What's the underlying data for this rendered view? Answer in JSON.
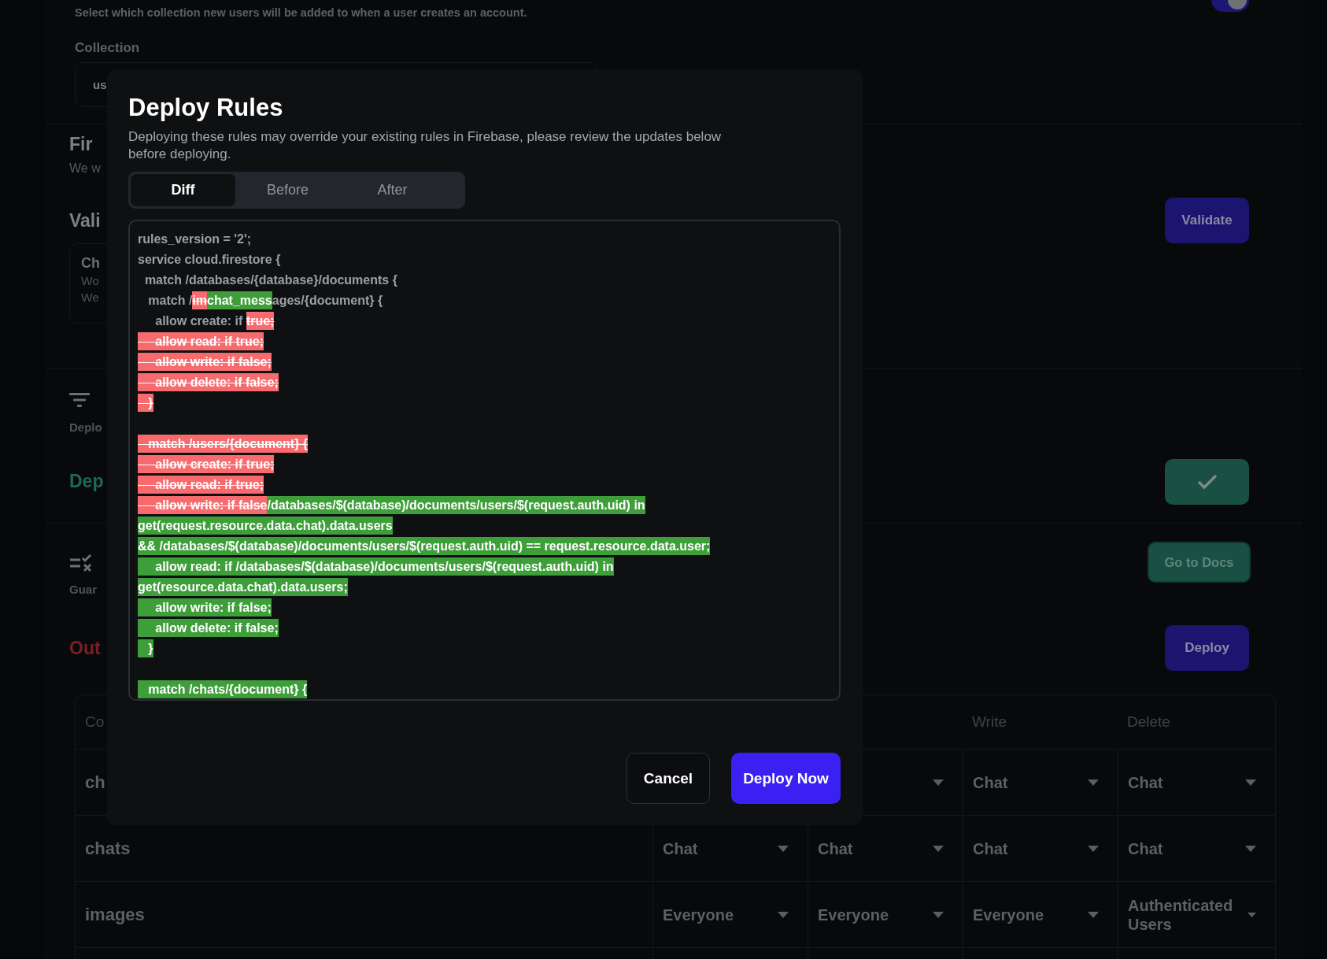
{
  "page": {
    "collection_hint": "Select which collection new users will be added to when a user creates an account.",
    "toggle": {
      "on": true
    },
    "collection_label": "Collection",
    "collection_field": {
      "value": "us"
    },
    "firestore": {
      "heading": "Fir",
      "text": "We w"
    },
    "validate": {
      "heading": "Vali",
      "button": "Validate",
      "card": {
        "title": "Ch",
        "lines": [
          "Wo",
          "We"
        ]
      }
    },
    "deploy_status": {
      "label": "Deplo",
      "heading": "Dep"
    },
    "guard": {
      "label": "Guar",
      "button": "Go to Docs"
    },
    "output": {
      "heading": "Out",
      "button": "Deploy"
    },
    "table": {
      "columns": [
        "Co",
        "",
        "",
        "Write",
        "Delete"
      ],
      "rows": [
        {
          "cells": [
            "ch",
            "",
            "",
            "Chat",
            "Chat"
          ]
        },
        {
          "cells": [
            "chats",
            "Chat",
            "Chat",
            "Chat",
            "Chat"
          ]
        },
        {
          "cells": [
            "images",
            "Everyone",
            "Everyone",
            "Everyone",
            "Authenticated Users"
          ]
        }
      ]
    }
  },
  "dialog": {
    "title": "Deploy Rules",
    "description": "Deploying these rules may override your existing rules in Firebase, please review the updates below before deploying.",
    "tabs": [
      {
        "label": "Diff",
        "selected": true
      },
      {
        "label": "Before",
        "selected": false
      },
      {
        "label": "After",
        "selected": false
      }
    ],
    "diff_lines": [
      {
        "kind": "code",
        "segments": [
          {
            "kind": "same",
            "text": "rules_version = '2';"
          }
        ]
      },
      {
        "kind": "code",
        "segments": [
          {
            "kind": "same",
            "text": "service cloud.firestore {"
          }
        ]
      },
      {
        "kind": "code",
        "segments": [
          {
            "kind": "same",
            "text": "  match /databases/{database}/documents {"
          }
        ]
      },
      {
        "kind": "code",
        "segments": [
          {
            "kind": "same",
            "text": "   match /"
          },
          {
            "kind": "removed",
            "text": "im"
          },
          {
            "kind": "added",
            "text": "chat_mess"
          },
          {
            "kind": "same",
            "text": "ages/{document} {"
          }
        ]
      },
      {
        "kind": "code",
        "segments": [
          {
            "kind": "same",
            "text": "     allow create: if "
          },
          {
            "kind": "removed",
            "text": "true;"
          }
        ]
      },
      {
        "kind": "code",
        "segments": [
          {
            "kind": "removed",
            "text": "     allow read: if true;"
          }
        ]
      },
      {
        "kind": "code",
        "segments": [
          {
            "kind": "removed",
            "text": "     allow write: if false;"
          }
        ]
      },
      {
        "kind": "code",
        "segments": [
          {
            "kind": "removed",
            "text": "     allow delete: if false;"
          }
        ]
      },
      {
        "kind": "code",
        "segments": [
          {
            "kind": "removed",
            "text": "   }"
          }
        ]
      },
      {
        "kind": "blank"
      },
      {
        "kind": "code",
        "segments": [
          {
            "kind": "removed",
            "text": "   match /users/{document} {"
          }
        ]
      },
      {
        "kind": "code",
        "segments": [
          {
            "kind": "removed",
            "text": "     allow create: if true;"
          }
        ]
      },
      {
        "kind": "code",
        "segments": [
          {
            "kind": "removed",
            "text": "     allow read: if true;"
          }
        ]
      },
      {
        "kind": "code",
        "segments": [
          {
            "kind": "removed",
            "text": "     allow write: if false"
          },
          {
            "kind": "added",
            "text": "/databases/$(database)/documents/users/$(request.auth.uid) in"
          }
        ]
      },
      {
        "kind": "code",
        "segments": [
          {
            "kind": "added",
            "text": "get(request.resource.data.chat).data.users"
          }
        ]
      },
      {
        "kind": "code",
        "segments": [
          {
            "kind": "added",
            "text": "&& /databases/$(database)/documents/users/$(request.auth.uid) == request.resource.data.user;"
          }
        ]
      },
      {
        "kind": "code",
        "segments": [
          {
            "kind": "added",
            "text": "     allow read: if /databases/$(database)/documents/users/$(request.auth.uid) in"
          }
        ]
      },
      {
        "kind": "code",
        "segments": [
          {
            "kind": "added",
            "text": "get(resource.data.chat).data.users;"
          }
        ]
      },
      {
        "kind": "code",
        "segments": [
          {
            "kind": "added",
            "text": "     allow write: if false;"
          }
        ]
      },
      {
        "kind": "code",
        "segments": [
          {
            "kind": "added",
            "text": "     allow delete: if false;"
          }
        ]
      },
      {
        "kind": "code",
        "segments": [
          {
            "kind": "added",
            "text": "   }"
          }
        ]
      },
      {
        "kind": "blank"
      },
      {
        "kind": "code",
        "segments": [
          {
            "kind": "added",
            "text": "   match /chats/{document} {"
          }
        ]
      }
    ],
    "buttons": {
      "cancel": "Cancel",
      "confirm": "Deploy Now"
    }
  }
}
